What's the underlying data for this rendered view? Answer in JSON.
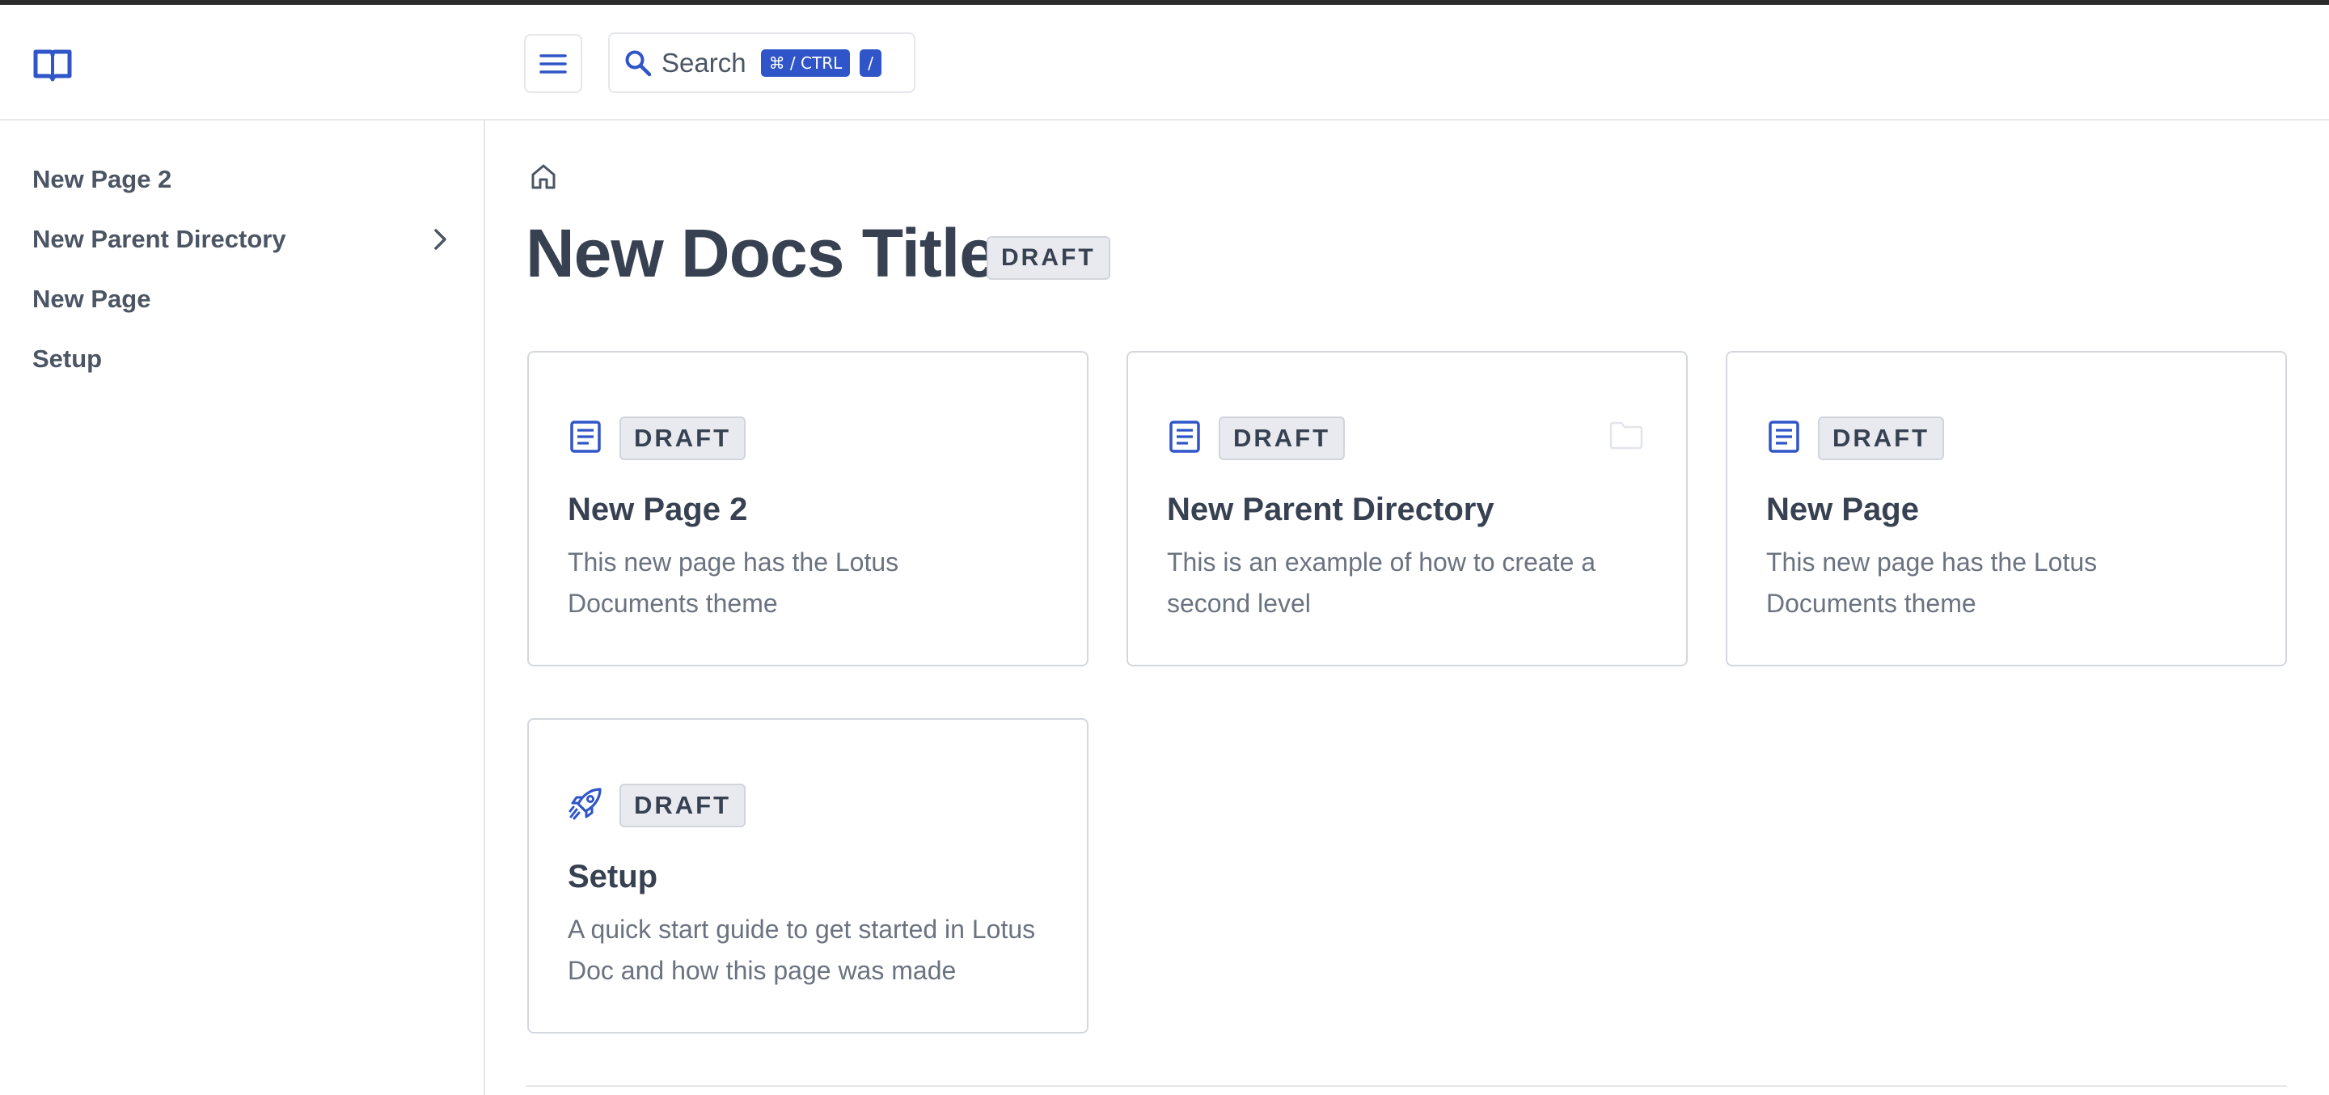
{
  "header": {
    "search_label": "Search",
    "shortcut_modifier": "⌘ / CTRL",
    "shortcut_key": "/"
  },
  "sidebar": {
    "items": [
      {
        "label": "New Page 2"
      },
      {
        "label": "New Parent Directory",
        "has_children": true
      },
      {
        "label": "New Page"
      },
      {
        "label": "Setup"
      }
    ]
  },
  "main": {
    "title": "New Docs Title",
    "title_badge": "DRAFT",
    "cards": [
      {
        "icon": "document-icon",
        "badge": "DRAFT",
        "title": "New Page 2",
        "description": "This new page has the Lotus Documents theme"
      },
      {
        "icon": "document-icon",
        "badge": "DRAFT",
        "title": "New Parent Directory",
        "description": "This is an example of how to create a second level",
        "secondary_icon": "folder-icon"
      },
      {
        "icon": "document-icon",
        "badge": "DRAFT",
        "title": "New Page",
        "description": "This new page has the Lotus Documents theme"
      },
      {
        "icon": "rocket-icon",
        "badge": "DRAFT",
        "title": "Setup",
        "description": "A quick start guide to get started in Lotus Doc and how this page was made"
      }
    ]
  },
  "colors": {
    "accent": "#2f55c8",
    "text": "#374151",
    "muted_text": "#6b7280",
    "border": "#d4d7dd",
    "badge_bg": "#e8eaf0"
  }
}
